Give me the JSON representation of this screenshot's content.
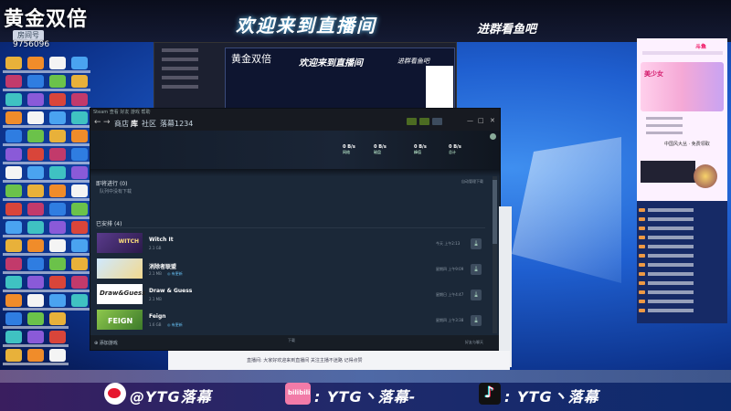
{
  "stream": {
    "brand": "黄金双倍",
    "room_badge": "房间号",
    "room_id": "9756096",
    "welcome": "欢迎来到直播间",
    "join_group": "进群看鱼吧"
  },
  "preview": {
    "brand": "黄金双倍",
    "welcome": "欢迎来到直播间",
    "join_group": "进群看鱼吧"
  },
  "steam": {
    "nav": {
      "store": "商店",
      "library": "库",
      "community": "社区",
      "username": "落幕1234"
    },
    "header_stats": [
      {
        "value": "0 B/s",
        "label": "网络"
      },
      {
        "value": "0 B/s",
        "label": "磁盘"
      },
      {
        "value": "0 B/s",
        "label": "峰值"
      },
      {
        "value": "0 B/s",
        "label": "总计"
      }
    ],
    "queue": {
      "title": "即将进行",
      "count": "(0)",
      "empty_text": "队列中没有下载",
      "right_label": "自动管理下载"
    },
    "installed": {
      "title": "已安排",
      "count": "(4)"
    },
    "games": [
      {
        "name": "Witch It",
        "size": "2.1 GB",
        "note": "",
        "date": "今天 上午2:13",
        "thumb_text": "WITCH"
      },
      {
        "name": "消除者联盟",
        "size": "2.1 MB",
        "note": "◎ 有更新",
        "date": "星期四 上午9:09",
        "thumb_text": ""
      },
      {
        "name": "Draw & Guess",
        "size": "2.1 MB",
        "note": "",
        "date": "星期日 上午4:47",
        "thumb_text": "Draw&Guess"
      },
      {
        "name": "Feign",
        "size": "1.6 GB",
        "note": "◎ 有更新",
        "date": "星期四 上午3:38",
        "thumb_text": "FEIGN"
      }
    ],
    "footer": {
      "add_game": "添加游戏",
      "center": "下载",
      "right": "好友与聊天"
    }
  },
  "chat_strip_text": "直播间: 大家好欢迎来到直播间 关注主播不迷路 记得点赞",
  "right_panel": {
    "logo": "斗鱼",
    "banner_text": "美少女",
    "item_label": "中国风大丛 · 免费领取",
    "chat_count": 12
  },
  "social": {
    "weibo": "@YTG落幕",
    "bilibili_label": "bilibili",
    "bilibili": ": YTG丶落幕-",
    "douyin": ": YTG丶落幕"
  },
  "colors": {
    "steam_bg": "#1b2838",
    "steam_accent": "#66c0f4",
    "banner_bg": "#0a0d1c",
    "bottom_bar": "#1f2a6b"
  }
}
